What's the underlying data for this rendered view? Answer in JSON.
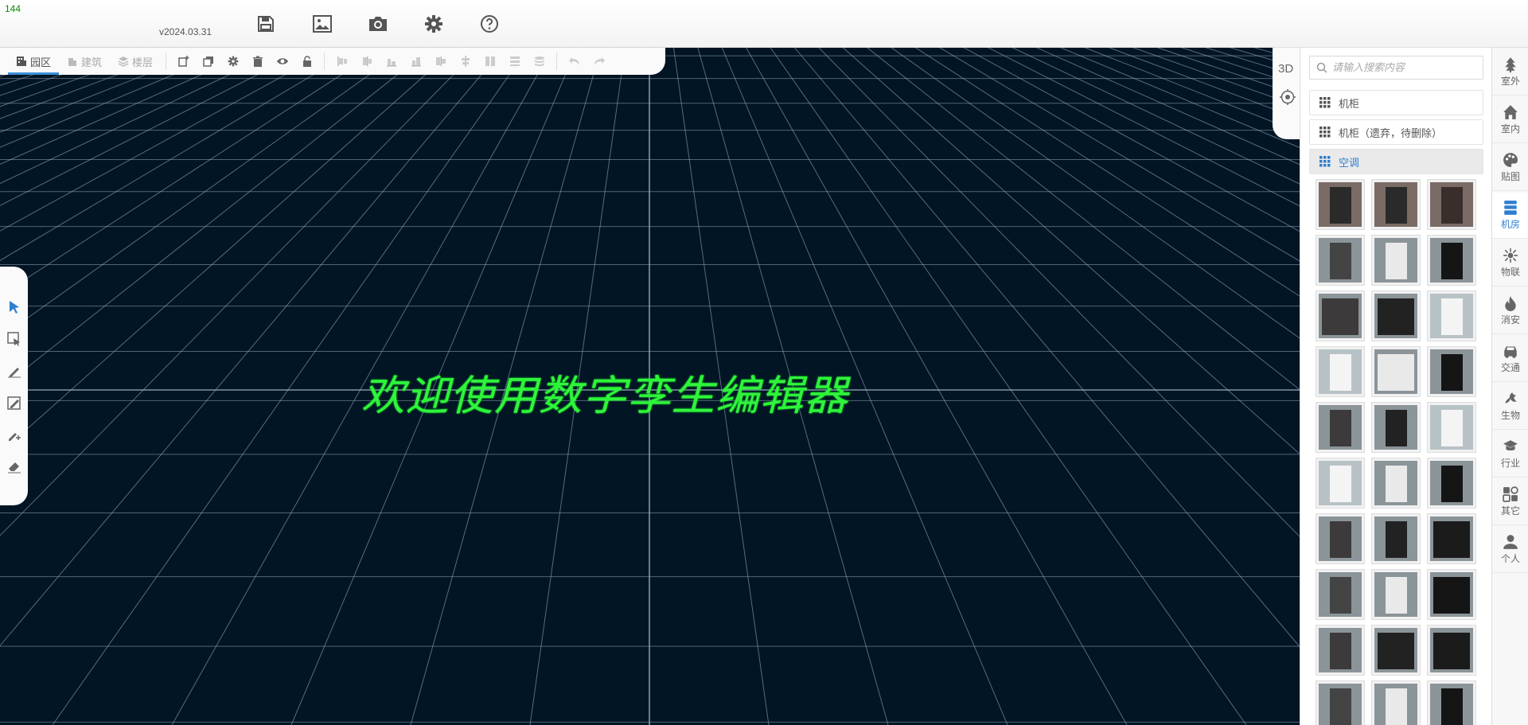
{
  "fps": "144",
  "version": "v2024.03.31",
  "header_buttons": [
    {
      "name": "save-icon"
    },
    {
      "name": "image-icon"
    },
    {
      "name": "camera-icon"
    },
    {
      "name": "gear-icon"
    },
    {
      "name": "help-icon"
    }
  ],
  "toolbar": {
    "tabs": [
      {
        "label": "园区",
        "icon": "map-icon",
        "active": true
      },
      {
        "label": "建筑",
        "icon": "building-icon",
        "active": false
      },
      {
        "label": "楼层",
        "icon": "layers-icon",
        "active": false
      }
    ],
    "tools": [
      "add-object-icon",
      "copy-icon",
      "gear-icon",
      "trash-icon",
      "eye-icon",
      "unlock-icon"
    ],
    "align_tools": [
      "align-left-icon",
      "align-center-h-icon",
      "align-right-icon",
      "align-top-icon",
      "align-center-v-icon",
      "align-bottom-icon",
      "distribute-h-icon",
      "distribute-v-icon",
      "stack-icon"
    ],
    "history_tools": [
      "undo-icon",
      "redo-icon"
    ]
  },
  "left_tools": [
    "pointer-icon",
    "select-box-icon",
    "pen-icon",
    "edit-shape-icon",
    "add-point-icon",
    "eraser-icon"
  ],
  "view": {
    "mode_label": "3D"
  },
  "welcome_text": "欢迎使用数字孪生编辑器",
  "colors": {
    "accent": "#2f7fd0",
    "welcome": "#2ff53a",
    "viewport_bg": "#021525",
    "grid": "#9fb3c4"
  },
  "panel": {
    "search_placeholder": "请输入搜索内容",
    "categories": [
      {
        "label": "机柜",
        "active": false
      },
      {
        "label": "机柜（遗弃，待删除）",
        "active": false
      },
      {
        "label": "空调",
        "active": true
      }
    ],
    "thumbnails_count": 30
  },
  "rail": [
    {
      "label": "室外",
      "icon": "tree-icon",
      "active": false
    },
    {
      "label": "室内",
      "icon": "home-icon",
      "active": false
    },
    {
      "label": "贴图",
      "icon": "palette-icon",
      "active": false
    },
    {
      "label": "机房",
      "icon": "server-icon",
      "active": true
    },
    {
      "label": "物联",
      "icon": "iot-icon",
      "active": false
    },
    {
      "label": "消安",
      "icon": "fire-icon",
      "active": false
    },
    {
      "label": "交通",
      "icon": "car-icon",
      "active": false
    },
    {
      "label": "生物",
      "icon": "bird-icon",
      "active": false
    },
    {
      "label": "行业",
      "icon": "graduation-icon",
      "active": false
    },
    {
      "label": "其它",
      "icon": "apps-icon",
      "active": false
    },
    {
      "label": "个人",
      "icon": "user-icon",
      "active": false
    }
  ]
}
